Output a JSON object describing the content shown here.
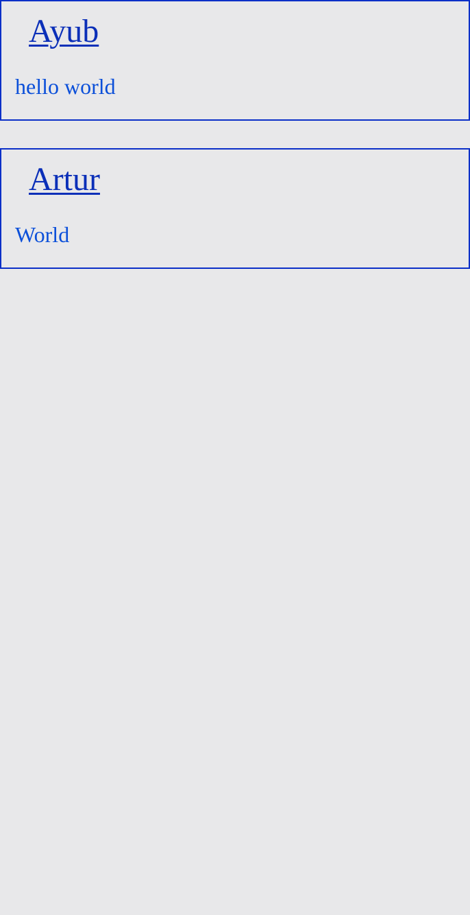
{
  "posts": [
    {
      "author": "Ayub",
      "text": "hello world"
    },
    {
      "author": "Artur",
      "text": "World"
    }
  ],
  "colors": {
    "background": "#e8e8ea",
    "border": "#0b2fc8",
    "title": "#0b2fb8",
    "text": "#0b4fd9"
  }
}
